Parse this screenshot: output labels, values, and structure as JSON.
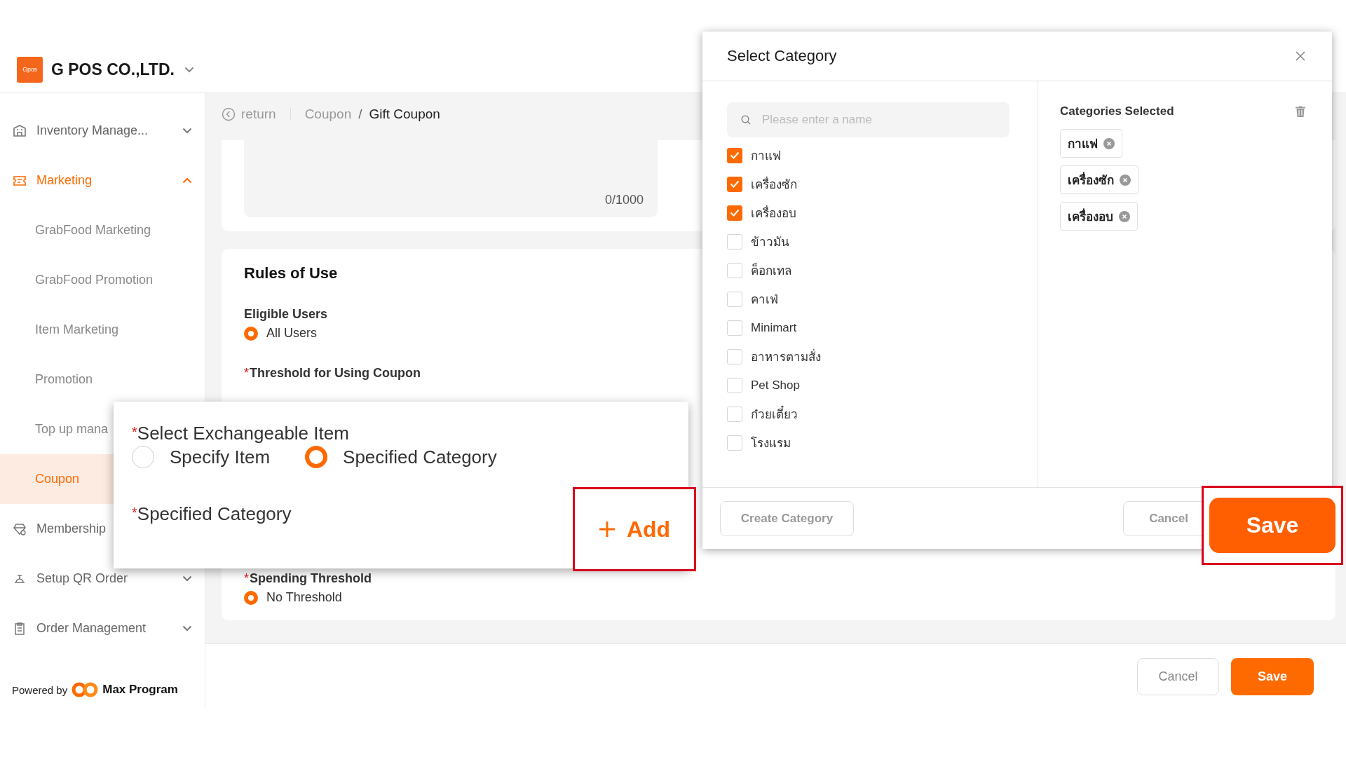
{
  "header": {
    "logo": "Gpos",
    "company": "G POS CO.,LTD."
  },
  "sidebar": {
    "items": [
      {
        "label": "Inventory Manage...",
        "kind": "group",
        "expanded": false,
        "selected": false
      },
      {
        "label": "Marketing",
        "kind": "group",
        "expanded": true,
        "selected": false
      },
      {
        "label": "GrabFood Marketing",
        "kind": "sub",
        "selected": false
      },
      {
        "label": "GrabFood Promotion",
        "kind": "sub",
        "selected": false
      },
      {
        "label": "Item Marketing",
        "kind": "sub",
        "selected": false
      },
      {
        "label": "Promotion",
        "kind": "sub",
        "selected": false
      },
      {
        "label": "Top up mana",
        "kind": "sub",
        "selected": false
      },
      {
        "label": "Coupon",
        "kind": "sub",
        "selected": true
      },
      {
        "label": "Membership",
        "kind": "group",
        "selected": false
      },
      {
        "label": "Setup QR Order",
        "kind": "group",
        "expanded": false,
        "selected": false
      },
      {
        "label": "Order Management",
        "kind": "group",
        "expanded": false,
        "selected": false
      }
    ],
    "powered_by": "Powered by",
    "brand": "Max Program"
  },
  "breadcrumb": {
    "return": "return",
    "items": [
      "Coupon",
      "Gift Coupon"
    ],
    "separator": "/"
  },
  "description": {
    "counter": "0/1000"
  },
  "required_marker": "*",
  "rules": {
    "title": "Rules of Use",
    "fields": [
      {
        "label": "Eligible Users",
        "required": false,
        "options": [
          {
            "label": "All Users",
            "selected": true
          }
        ]
      },
      {
        "label": "Threshold for Using Coupon",
        "required": true
      },
      {
        "label": "Spending Threshold",
        "required": true,
        "options": [
          {
            "label": "No Threshold",
            "selected": true
          }
        ]
      }
    ]
  },
  "footer": {
    "buttons": [
      {
        "label": "Cancel",
        "kind": "secondary"
      },
      {
        "label": "Save",
        "kind": "primary"
      }
    ]
  },
  "callout": {
    "title": "Select Exchangeable Item",
    "required": true,
    "options": [
      {
        "label": "Specify Item",
        "selected": false
      },
      {
        "label": "Specified Category",
        "selected": true
      }
    ],
    "category_label": "Specified Category",
    "category_required": true,
    "add_button": "Add"
  },
  "dialog": {
    "title": "Select Category",
    "search": {
      "placeholder": "Please enter a name"
    },
    "categories": [
      {
        "label": "กาแฟ",
        "checked": true
      },
      {
        "label": "เครื่องซัก",
        "checked": true
      },
      {
        "label": "เครื่องอบ",
        "checked": true
      },
      {
        "label": "ข้าวมัน",
        "checked": false
      },
      {
        "label": "ค็อกเทล",
        "checked": false
      },
      {
        "label": "คาเฟ่",
        "checked": false
      },
      {
        "label": "Minimart",
        "checked": false
      },
      {
        "label": "อาหารตามสั่ง",
        "checked": false
      },
      {
        "label": "Pet Shop",
        "checked": false
      },
      {
        "label": "ก๋วยเตี๋ยว",
        "checked": false
      },
      {
        "label": "โรงแรม",
        "checked": false
      }
    ],
    "selected_title": "Categories Selected",
    "selected_tags": [
      "กาแฟ",
      "เครื่องซัก",
      "เครื่องอบ"
    ],
    "create_button": "Create Category",
    "cancel_button": "Cancel",
    "save_button": "Save"
  }
}
